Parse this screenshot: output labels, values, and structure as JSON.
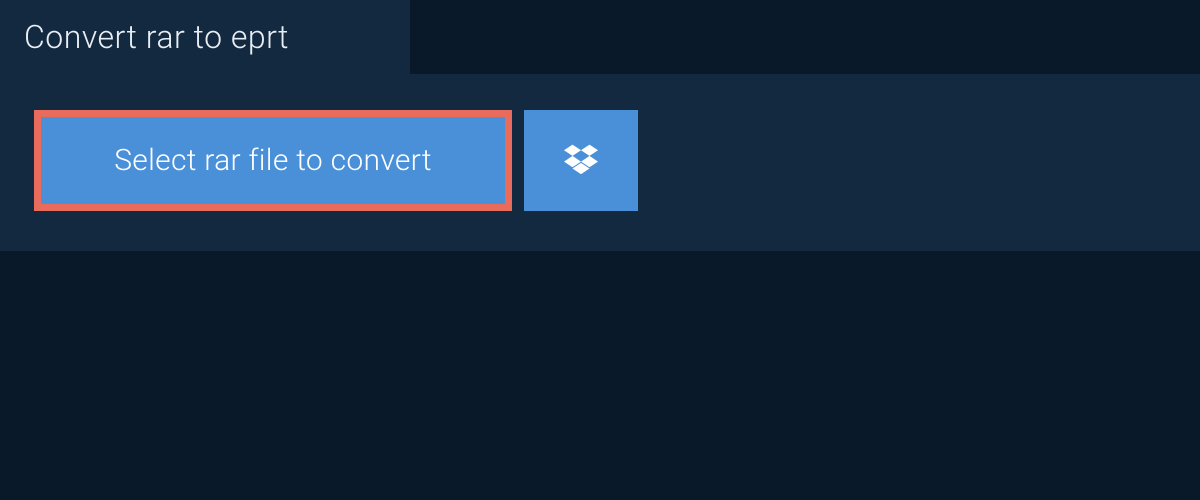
{
  "tab": {
    "title": "Convert rar to eprt"
  },
  "actions": {
    "select_file_label": "Select rar file to convert"
  }
}
